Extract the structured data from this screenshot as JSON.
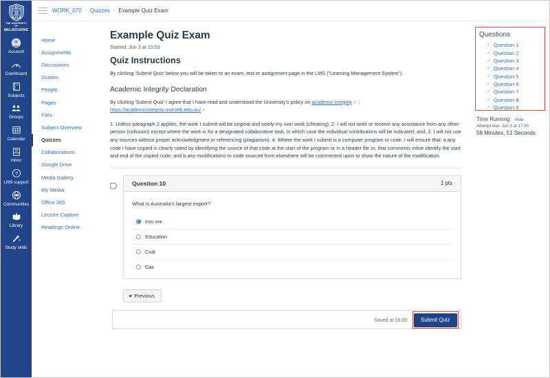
{
  "global_nav": {
    "logo": {
      "line1": "THE UNIVERSITY OF",
      "line2": "MELBOURNE",
      "icon": "melbourne-crest-icon"
    },
    "items": [
      {
        "label": "Account",
        "icon": "account-avatar-icon"
      },
      {
        "label": "Dashboard",
        "icon": "dashboard-speedometer-icon"
      },
      {
        "label": "Subjects",
        "icon": "subjects-book-icon"
      },
      {
        "label": "Groups",
        "icon": "groups-people-icon"
      },
      {
        "label": "Calendar",
        "icon": "calendar-grid-icon"
      },
      {
        "label": "Inbox",
        "icon": "inbox-tray-icon"
      },
      {
        "label": "LMS support",
        "icon": "help-question-icon"
      },
      {
        "label": "Communities",
        "icon": "communities-globe-icon"
      },
      {
        "label": "Library",
        "icon": "library-book-icon"
      },
      {
        "label": "Study skills",
        "icon": "study-skills-sparkle-icon"
      }
    ]
  },
  "course_nav": {
    "items": [
      {
        "label": "Home",
        "active": false
      },
      {
        "label": "Assignments",
        "active": false
      },
      {
        "label": "Discussions",
        "active": false
      },
      {
        "label": "Grades",
        "active": false
      },
      {
        "label": "People",
        "active": false
      },
      {
        "label": "Pages",
        "active": false
      },
      {
        "label": "Files",
        "active": false
      },
      {
        "label": "Subject Overview",
        "active": false
      },
      {
        "label": "Quizzes",
        "active": true
      },
      {
        "label": "Collaborations",
        "active": false
      },
      {
        "label": "Google Drive",
        "active": false
      },
      {
        "label": "Media Gallery",
        "active": false
      },
      {
        "label": "My Media",
        "active": false
      },
      {
        "label": "Office 365",
        "active": false
      },
      {
        "label": "Lecture Capture",
        "active": false
      },
      {
        "label": "Readings Online",
        "active": false
      }
    ]
  },
  "breadcrumb": {
    "menu_icon": "hamburger-menu-icon",
    "items": [
      "WORK_070",
      "Quizzes",
      "Example Quiz Exam"
    ],
    "separator": "›"
  },
  "main": {
    "title": "Example Quiz Exam",
    "started": "Started: Jun 3 at 15:53",
    "instructions_heading": "Quiz Instructions",
    "instructions_body": "By clicking 'Submit Quiz' below you will be taken to an exam, test or assignment page in the LMS (\"Learning Management System\").",
    "declaration_heading": "Academic Integrity Declaration",
    "declaration_intro": "By clicking 'Submit Quiz' I agree that I have read and understood the University's policy on ",
    "declaration_link_text": "academic integrity",
    "declaration_link_url_text": "https://academicintegrity.unimelb.edu.au/",
    "declaration_semicolon": " ; ",
    "external_link_glyph": "↗",
    "declaration_body": "1. Unless paragraph 2 applies, the work I submit will be original and solely my own work (cheating); 2. I will not seek or receive any assistance from any other person (collusion) except where the work is for a designated collaborative task, in which case the individual contributions will be indicated; and, 3. I will not use any sources without proper acknowledgment or referencing (plagiarism). 4. Where the work I submit is a computer program or code, I will ensure that: a.any code I have copied is clearly noted by identifying the source of that code at the start of the program or in a header file or, that comments inline identify the start and end of the copied code; and b.any modifications to code sourced from elsewhere will be commented upon to show the nature of the modification."
  },
  "question": {
    "flag_icon": "flag-bookmark-icon",
    "name": "Question 10",
    "points": "1 pts",
    "prompt": "What is Australia's largest export?",
    "answers": [
      {
        "label": "Iron ore",
        "selected": true
      },
      {
        "label": "Education",
        "selected": false
      },
      {
        "label": "Coal",
        "selected": false
      },
      {
        "label": "Gas",
        "selected": false
      }
    ]
  },
  "footer": {
    "previous_label": "Previous",
    "previous_arrow": "◀",
    "saved_at": "Saved at 16:00",
    "submit_label": "Submit Quiz"
  },
  "rail": {
    "panel_title": "Questions",
    "check_glyph": "✓",
    "questions": [
      "Question 1",
      "Question 2",
      "Question 3",
      "Question 4",
      "Question 5",
      "Question 6",
      "Question 7",
      "Question 8",
      "Question 9"
    ],
    "timer_label": "Time Running:",
    "timer_hide": "Hide",
    "attempt_due": "Attempt due: Jun 3 at 17:00",
    "time_remaining": "58 Minutes, 51 Seconds"
  },
  "colors": {
    "brand_navy": "#20458a",
    "link_blue": "#2b6ec4",
    "highlight_red": "#e8442a",
    "submit_navy": "#1f4388",
    "text_dark": "#2d3b45"
  }
}
